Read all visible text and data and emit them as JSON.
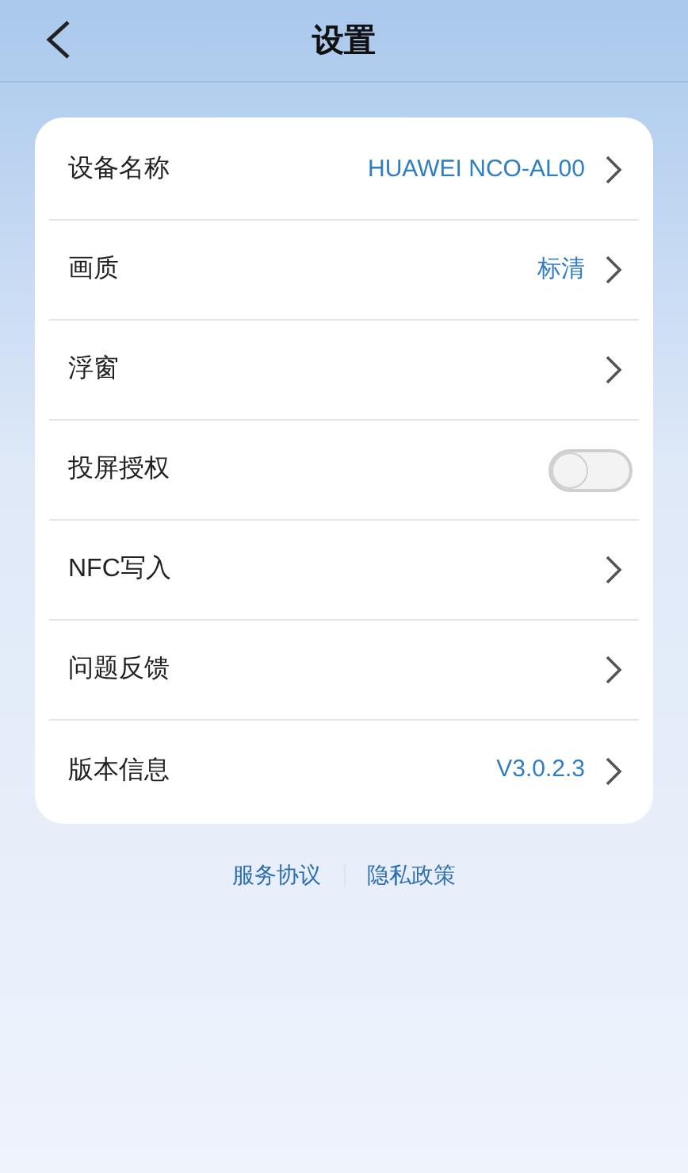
{
  "header": {
    "title": "设置"
  },
  "settings": [
    {
      "kind": "link",
      "label": "设备名称",
      "value": "HUAWEI NCO-AL00"
    },
    {
      "kind": "link",
      "label": "画质",
      "value": "标清"
    },
    {
      "kind": "link",
      "label": "浮窗"
    },
    {
      "kind": "toggle",
      "label": "投屏授权",
      "on": false
    },
    {
      "kind": "link",
      "label": "NFC写入"
    },
    {
      "kind": "link",
      "label": "问题反馈"
    },
    {
      "kind": "link",
      "label": "版本信息",
      "value": "V3.0.2.3"
    }
  ],
  "footer_links": [
    "服务协议",
    "隐私政策"
  ]
}
